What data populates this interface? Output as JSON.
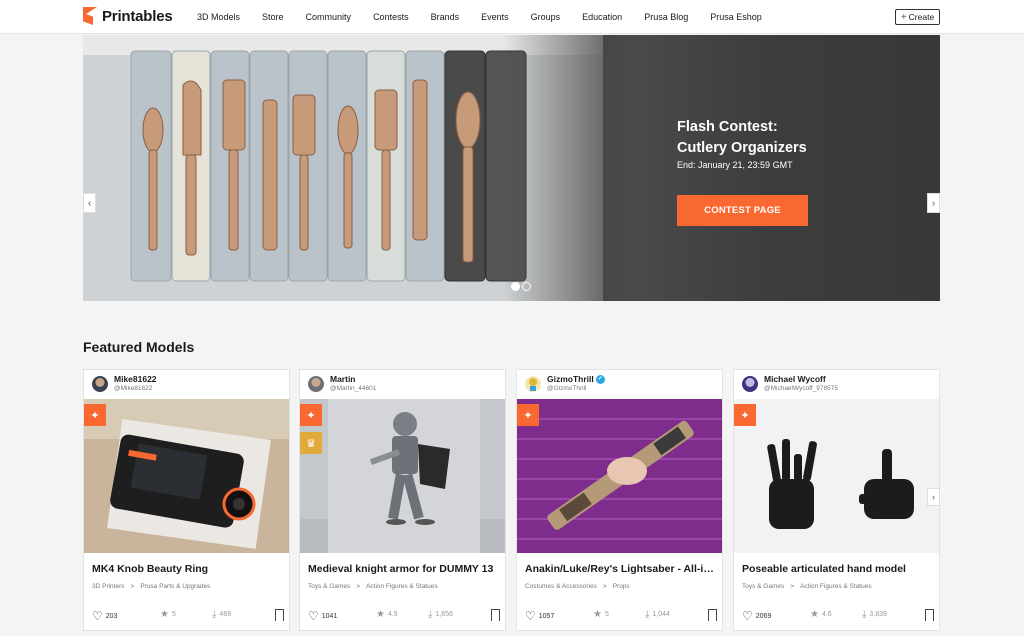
{
  "header": {
    "logo_text": "Printables",
    "nav": [
      "3D Models",
      "Store",
      "Community",
      "Contests",
      "Brands",
      "Events",
      "Groups",
      "Education",
      "Prusa Blog",
      "Prusa Eshop"
    ],
    "create_label": "Create",
    "create_icon": "plus-icon"
  },
  "hero": {
    "title_line1": "Flash Contest:",
    "title_line2": "Cutlery Organizers",
    "end_text": "End: January 21, 23:59 GMT",
    "button_label": "CONTEST PAGE",
    "prev_icon": "chevron-left-icon",
    "next_icon": "chevron-right-icon",
    "slides": 2,
    "active_slide": 1
  },
  "featured": {
    "title": "Featured Models",
    "cards": [
      {
        "user": "Mike81622",
        "handle": "@Mike81622",
        "title": "MK4 Knob Beauty Ring",
        "category": "3D Printers",
        "subcategory": "Prusa Parts & Upgrades",
        "likes": "203",
        "rating": "5",
        "downloads": "469",
        "badges": [
          "bulb"
        ]
      },
      {
        "user": "Martin",
        "handle": "@Martin_44601",
        "title": "Medieval knight armor for DUMMY 13",
        "category": "Toys & Games",
        "subcategory": "Action Figures & Statues",
        "likes": "1041",
        "rating": "4.9",
        "downloads": "1,656",
        "badges": [
          "bulb",
          "trophy"
        ]
      },
      {
        "user": "GizmoThrill",
        "handle": "@GizmoThrill",
        "title": "Anakin/Luke/Rey's Lightsaber - All-in-one",
        "category": "Costumes & Accessories",
        "subcategory": "Props",
        "likes": "1057",
        "rating": "5",
        "downloads": "1,044",
        "badges": [
          "bulb"
        ],
        "verified": true
      },
      {
        "user": "Michael Wycoff",
        "handle": "@MichaelWycoff_978575",
        "title": "Poseable articulated hand model",
        "category": "Toys & Games",
        "subcategory": "Action Figures & Statues",
        "likes": "2069",
        "rating": "4.6",
        "downloads": "3,839",
        "badges": [
          "bulb"
        ]
      }
    ]
  },
  "colors": {
    "accent": "#fa6831",
    "trophy": "#e2a93b",
    "verified": "#2ea6e5",
    "hero_dark": "#3d3d3d"
  }
}
